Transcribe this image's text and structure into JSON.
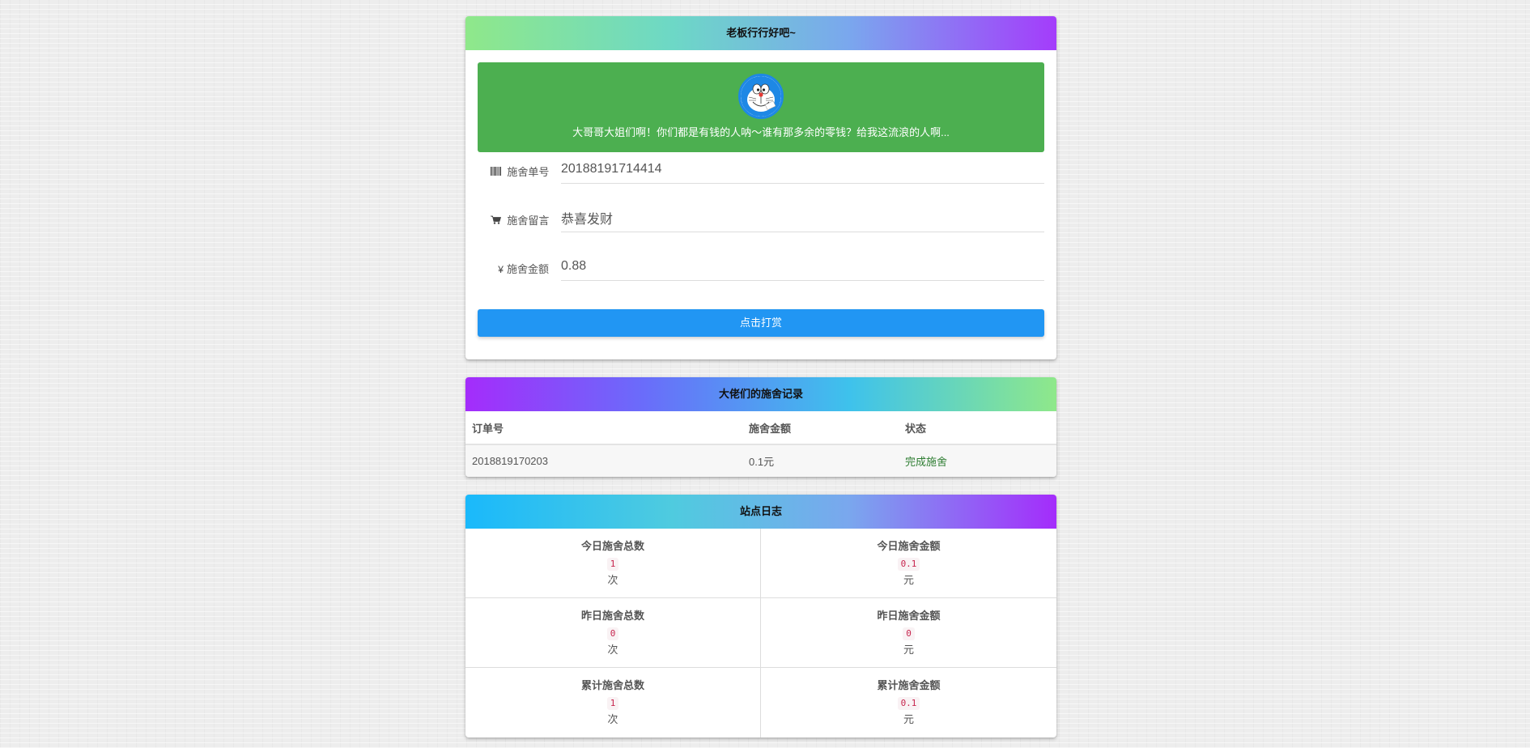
{
  "donate": {
    "header_title": "老板行行好吧~",
    "banner_text": "大哥哥大姐们啊！你们都是有钱的人呐～谁有那多余的零钱？给我这流浪的人啊...",
    "order_label": "施舍单号",
    "order_value": "20188191714414",
    "message_label": "施舍留言",
    "message_value": "恭喜发财",
    "amount_label": "施舍金额",
    "amount_value": "0.88",
    "submit_label": "点击打赏",
    "icons": {
      "order": "barcode-icon",
      "message": "cart-icon",
      "amount": "yen-icon",
      "avatar": "doraemon-avatar"
    }
  },
  "records": {
    "header_title": "大佬们的施舍记录",
    "columns": [
      "订单号",
      "施舍金额",
      "状态"
    ],
    "rows": [
      {
        "order": "2018819170203",
        "amount": "0.1元",
        "status": "完成施舍"
      }
    ]
  },
  "stats": {
    "header_title": "站点日志",
    "items": [
      {
        "title": "今日施舍总数",
        "value": "1",
        "unit": "次"
      },
      {
        "title": "今日施舍金额",
        "value": "0.1",
        "unit": "元"
      },
      {
        "title": "昨日施舍总数",
        "value": "0",
        "unit": "次"
      },
      {
        "title": "昨日施舍金额",
        "value": "0",
        "unit": "元"
      },
      {
        "title": "累计施舍总数",
        "value": "1",
        "unit": "次"
      },
      {
        "title": "累计施舍金额",
        "value": "0.1",
        "unit": "元"
      }
    ]
  },
  "colors": {
    "banner": "#4caf50",
    "button": "#2196f3",
    "status_ok": "#2e7d32",
    "code_text": "#c7254e"
  }
}
